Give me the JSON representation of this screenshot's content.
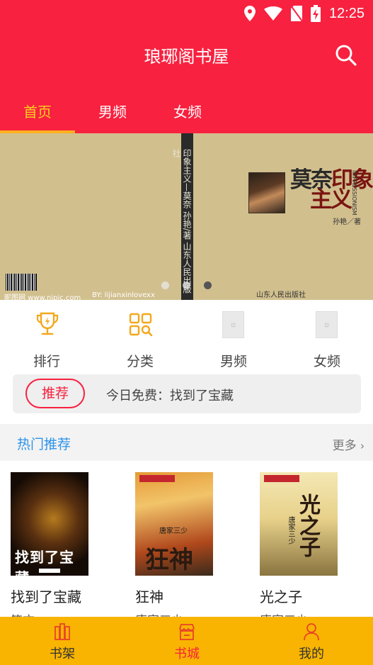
{
  "status_bar": {
    "time": "12:25"
  },
  "header": {
    "title": "琅琊阁书屋"
  },
  "tabs": [
    {
      "label": "首页",
      "active": true
    },
    {
      "label": "男频",
      "active": false
    },
    {
      "label": "女频",
      "active": false
    }
  ],
  "banner": {
    "cover_title_line1": "印象",
    "cover_title_line2": "主义",
    "cover_title_name": "莫奈",
    "spine_text": "印象主义—莫奈  孙艳/著  山东人民出版社",
    "cover_vertical": "IMPRESSIONISM",
    "author": "孙艳／著",
    "publisher": "山东人民出版社",
    "watermark": "昵图网 www.nipic.com",
    "watermark2": "BY: lijianxinlovexx",
    "slide_count": 3,
    "active_slide": 3
  },
  "categories": [
    {
      "label": "排行",
      "icon": "trophy-icon"
    },
    {
      "label": "分类",
      "icon": "category-grid-icon"
    },
    {
      "label": "男频",
      "icon": "image-placeholder-icon"
    },
    {
      "label": "女频",
      "icon": "image-placeholder-icon"
    }
  ],
  "recommend": {
    "badge": "推荐",
    "text": "今日免费：找到了宝藏"
  },
  "hot_section": {
    "title": "热门推荐",
    "more": "更多"
  },
  "books": [
    {
      "title": "找到了宝藏",
      "author": "笑方",
      "cover_text": "找到了宝藏"
    },
    {
      "title": "狂神",
      "author": "唐家三少",
      "cover_text": "狂神"
    },
    {
      "title": "光之子",
      "author": "唐家三少",
      "cover_text": "光之子"
    }
  ],
  "bottom_nav": [
    {
      "label": "书架",
      "icon": "bookshelf-icon",
      "active": false
    },
    {
      "label": "书城",
      "icon": "store-icon",
      "active": true
    },
    {
      "label": "我的",
      "icon": "user-icon",
      "active": false
    }
  ],
  "colors": {
    "primary_red": "#f8213f",
    "tab_active": "#ffd21e",
    "nav_bar": "#f8b400",
    "section_title": "#2e93e9"
  }
}
